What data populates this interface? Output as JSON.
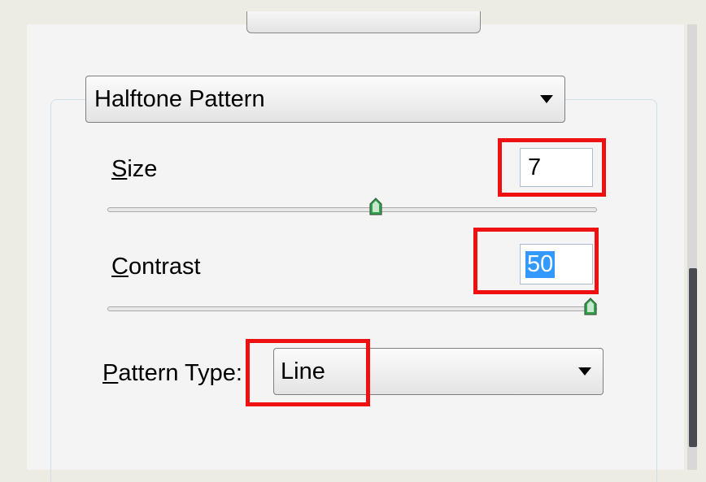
{
  "effect_select": {
    "value": "Halftone Pattern",
    "icon": "chevron-down-icon"
  },
  "size": {
    "label_accel": "S",
    "label_rest": "ize",
    "value": "7",
    "slider_fraction": 0.55
  },
  "contrast": {
    "label_accel": "C",
    "label_rest": "ontrast",
    "value": "50",
    "slider_fraction": 1.0
  },
  "pattern_type": {
    "label_accel": "P",
    "label_rest": "attern Type:",
    "value": "Line",
    "icon": "chevron-down-icon"
  },
  "colors": {
    "highlight": "#ef1111",
    "selection": "#3399ff",
    "thumb": "#2fa34a"
  }
}
